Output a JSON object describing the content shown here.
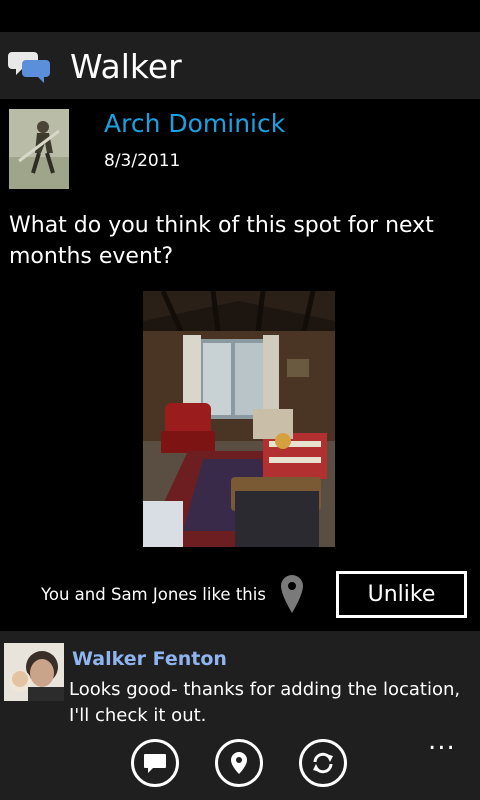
{
  "app": {
    "title": "Walker"
  },
  "post": {
    "author": "Arch Dominick",
    "date": "8/3/2011",
    "text": "What do you think of this spot for next months event?",
    "likes_text": "You and Sam Jones like this",
    "unlike_label": "Unlike"
  },
  "comment": {
    "author": "Walker Fenton",
    "text": "Looks good- thanks for adding the location, I'll check it out."
  },
  "appbar": {
    "buttons": [
      "comment-icon",
      "location-icon",
      "refresh-icon"
    ],
    "more_label": "..."
  },
  "colors": {
    "accent": "#1ba1e2",
    "comment_author": "#8fb4f0",
    "panel": "#1f1f1f"
  }
}
